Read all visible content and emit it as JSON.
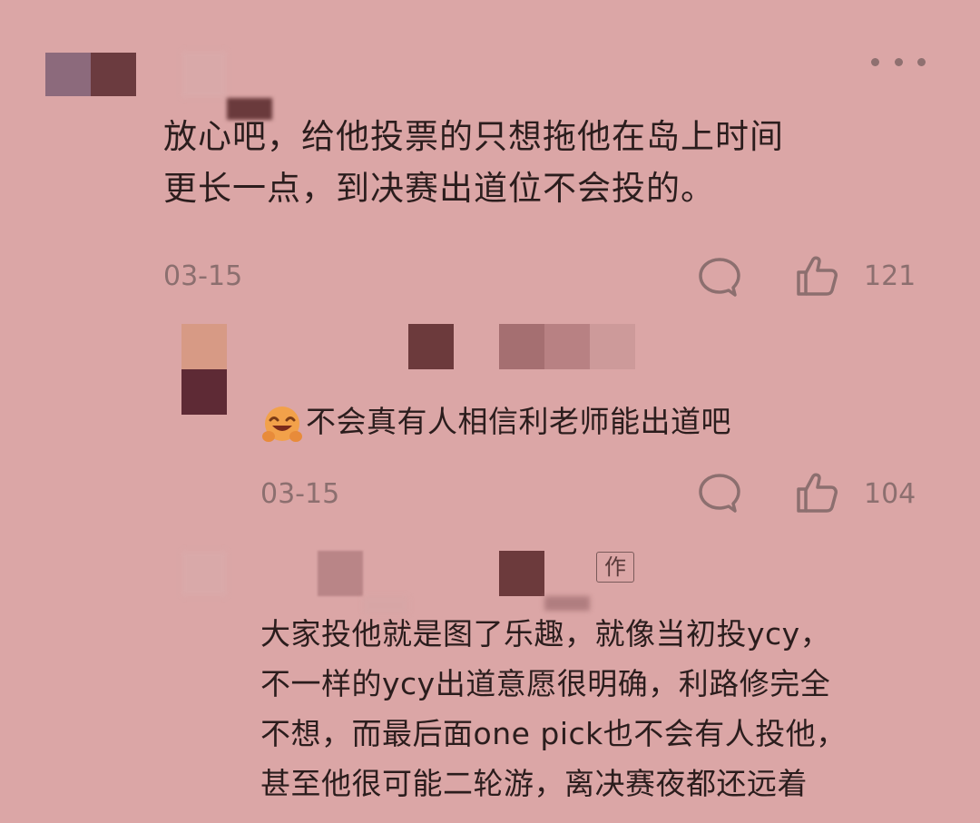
{
  "more_menu": {
    "icon": "more-dots-icon"
  },
  "comment": {
    "text": "放心吧，给他投票的只想拖他在岛上时间\n更长一点，到决赛出道位不会投的。",
    "date": "03-15",
    "like_count": "121",
    "comment_icon": "speech-bubble-icon",
    "like_icon": "thumbs-up-icon"
  },
  "reply1": {
    "emoji": "laughing-face-emoji",
    "text": "不会真有人相信利老师能出道吧",
    "date": "03-15",
    "like_count": "104",
    "comment_icon": "speech-bubble-icon",
    "like_icon": "thumbs-up-icon"
  },
  "reply2": {
    "name_fragment": "作",
    "text": "大家投他就是图了乐趣，就像当初投ycy，\n不一样的ycy出道意愿很明确，利路修完全\n不想，而最后面one pick也不会有人投他，\n甚至他很可能二轮游，离决赛夜都还远着"
  },
  "colors": {
    "background": "#dba6a6",
    "text": "#2b1d1d",
    "meta": "#8c6f6f"
  }
}
